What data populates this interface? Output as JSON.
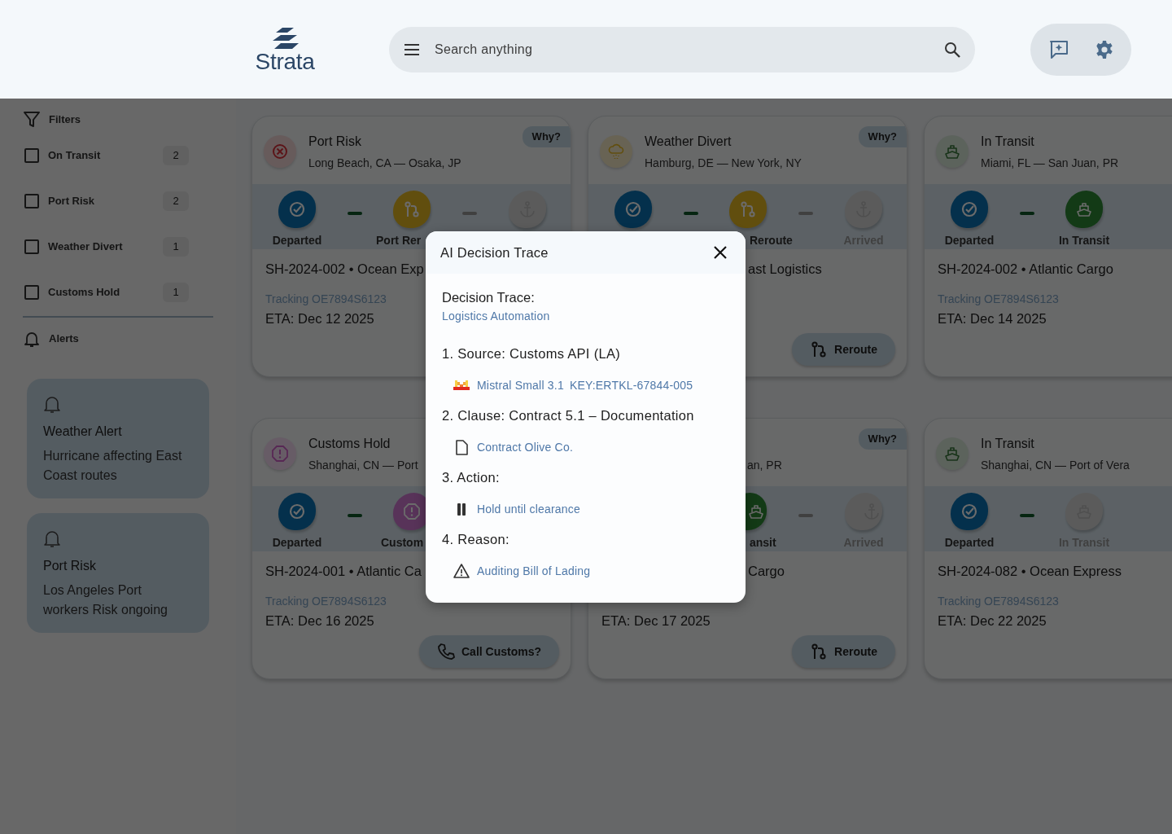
{
  "header": {
    "logo": "Strata",
    "search": {
      "placeholder": "Search anything"
    }
  },
  "sidebar": {
    "filters_label": "Filters",
    "filters": [
      {
        "label": "On Transit",
        "count": "2",
        "checked": false
      },
      {
        "label": "Port Risk",
        "count": "2",
        "checked": false
      },
      {
        "label": "Weather Divert",
        "count": "1",
        "checked": false
      },
      {
        "label": "Customs Hold",
        "count": "1",
        "checked": false
      }
    ],
    "alerts_label": "Alerts",
    "alerts": [
      {
        "title": "Weather Alert",
        "text": "Hurricane affecting East Coast routes"
      },
      {
        "title": "Port Risk",
        "text": "Los Angeles Port workers Risk ongoing"
      }
    ]
  },
  "shipments": [
    {
      "kind": "port_risk",
      "title": "Port Risk",
      "route": "Long Beach, CA — Osaka, JP",
      "why": "Why?",
      "steps": [
        {
          "kind": "departed",
          "label": "Departed",
          "done": true
        },
        {
          "kind": "reroute",
          "label": "Port Rer",
          "done": true,
          "link_done": true
        },
        {
          "kind": "arrived",
          "done": false,
          "link_done": false
        }
      ],
      "name": "SH-2024-002 • Ocean Exp",
      "tracking": "Tracking OE7894S6123",
      "eta": "ETA: Dec 12 2025"
    },
    {
      "kind": "weather",
      "title": "Weather Divert",
      "route": "Hamburg, DE — New York, NY",
      "why": "Why?",
      "steps": [
        {
          "kind": "departed",
          "done": true
        },
        {
          "kind": "reroute",
          "label": "Reroute",
          "done": true,
          "link_done": true
        },
        {
          "kind": "arrived",
          "label": "Arrived",
          "done": false,
          "link_done": false
        }
      ],
      "name": "ast Logistics",
      "action": {
        "kind": "reroute",
        "label": "Reroute"
      }
    },
    {
      "kind": "transit",
      "title": "In Transit",
      "route": "Miami, FL — San Juan, PR",
      "steps": [
        {
          "kind": "departed",
          "label": "Departed",
          "done": true
        },
        {
          "kind": "transit",
          "label": "In Transit",
          "done": true,
          "link_done": true
        }
      ],
      "name": "SH-2024-002 • Atlantic Cargo",
      "tracking": "Tracking OE7894S6123",
      "eta": "ETA: Dec 14 2025"
    },
    {
      "kind": "customs",
      "title": "Customs Hold",
      "route": "Shanghai, CN — Port",
      "steps": [
        {
          "kind": "departed",
          "label": "Departed",
          "done": true
        },
        {
          "kind": "customs",
          "label": "Custom",
          "done": true,
          "link_done": true
        }
      ],
      "name": "SH-2024-001 • Atlantic Ca",
      "tracking": "Tracking OE7894S6123",
      "eta": "ETA: Dec 16 2025",
      "action": {
        "kind": "call",
        "label": "Call Customs?"
      }
    },
    {
      "why": "Why?",
      "route": "an, PR",
      "steps": [
        {
          "kind": "transit",
          "label": "ansit",
          "done": true
        },
        {
          "kind": "arrived",
          "label": "Arrived",
          "done": false,
          "link_done": false
        }
      ],
      "name": "Cargo",
      "eta": "ETA: Dec 17 2025",
      "action": {
        "kind": "reroute",
        "label": "Reroute"
      }
    },
    {
      "kind": "transit",
      "title": "In Transit",
      "route": "Shanghai, CN — Port of Vera",
      "steps": [
        {
          "kind": "departed",
          "label": "Departed",
          "done": true
        },
        {
          "kind": "transit",
          "label": "In Transit",
          "done": false,
          "link_done": true
        }
      ],
      "name": "SH-2024-082 • Ocean Express",
      "tracking": "Tracking OE7894S6123",
      "eta": "ETA: Dec 22 2025"
    }
  ],
  "dialog": {
    "title": "AI Decision Trace",
    "heading": "Decision Trace:",
    "subheading": "Logistics Automation",
    "items": [
      {
        "text": "1. Source: Customs API (LA)",
        "detail": {
          "kind": "model",
          "text": "Mistral Small 3.1",
          "key": "KEY:ERTKL-67844-005"
        }
      },
      {
        "text": "2. Clause: Contract 5.1 – Documentation",
        "detail": {
          "kind": "document",
          "text": "Contract Olive Co."
        }
      },
      {
        "text": "3. Action:",
        "detail": {
          "kind": "pause",
          "text": "Hold until clearance"
        }
      },
      {
        "text": "4. Reason:",
        "detail": {
          "kind": "warning",
          "text": "Auditing Bill of Lading"
        }
      }
    ]
  }
}
